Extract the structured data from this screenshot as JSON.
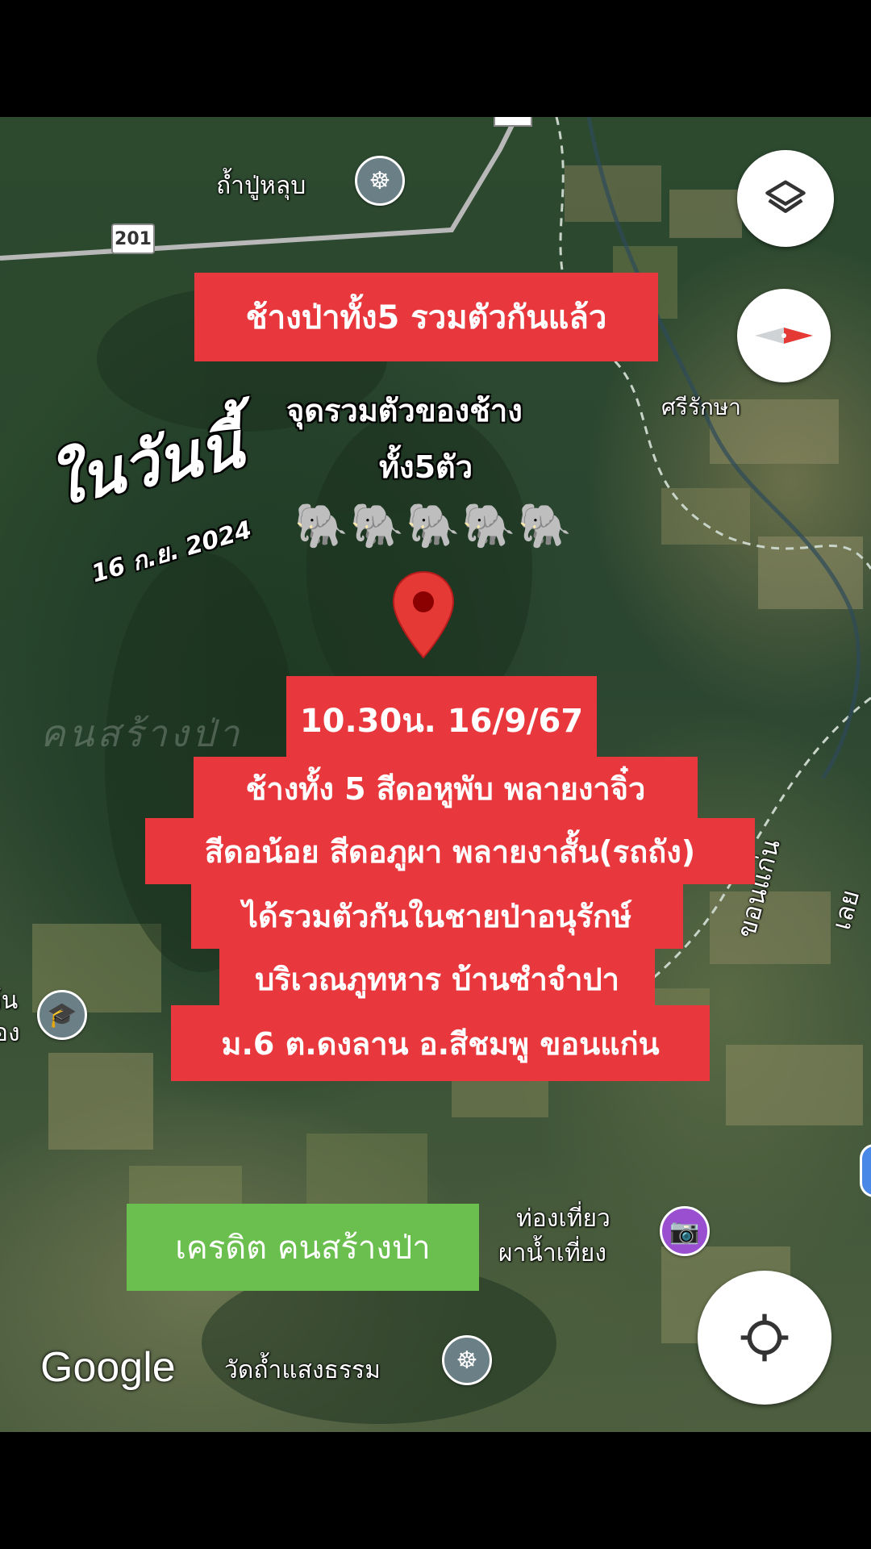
{
  "map": {
    "route_shield": "201",
    "places": {
      "tham_pu_lup": "ถ้ำปู่หลุบ",
      "si_rak_sa": "ศรีรักษา",
      "watermark": "คนสร้างป่า",
      "khon_kaen": "ขอนแก่น",
      "loei": "เลย",
      "left_edge_1": "ห้น",
      "left_edge_2": "อง",
      "tourism": "ท่องเที่ยว",
      "tourism_2": "ผาน้ำเที่ยง",
      "wat": "วัดถ้ำแสงธรรม"
    },
    "icons": {
      "temple_1": "dharma-wheel-icon",
      "temple_2": "dharma-wheel-icon",
      "school": "graduation-cap-icon",
      "tourism": "camera-icon",
      "pin": "map-pin-icon"
    },
    "google_logo": "Google"
  },
  "overlay": {
    "headline": "ช้างป่าทั้ง5 รวมตัวกันแล้ว",
    "gather_line1": "จุดรวมตัวของช้าง",
    "gather_line2": "ทั้ง5ตัว",
    "today": "ในวันนี้",
    "date": "16 ก.ย. 2024",
    "elephants": "🐘🐘🐘🐘🐘",
    "info_time": "10.30น. 16/9/67",
    "info_lines": [
      "ช้างทั้ง 5 สีดอหูพับ พลายงาจิ๋ว",
      "สีดอน้อย สีดอภูผา พลายงาสั้น(รถถัง)",
      "ได้รวมตัวกันในชายป่าอนุรักษ์",
      "บริเวณภูทหาร บ้านซำจำปา",
      "ม.6 ต.ดงลาน อ.สีชมพู ขอนแก่น"
    ],
    "credit": "เครดิต คนสร้างป่า"
  },
  "controls": {
    "layers": "layers-icon",
    "compass": "compass-icon",
    "location": "my-location-icon"
  },
  "colors": {
    "red_box": "#e8383d",
    "green_box": "#6bbf4e",
    "pin": "#e53935"
  }
}
